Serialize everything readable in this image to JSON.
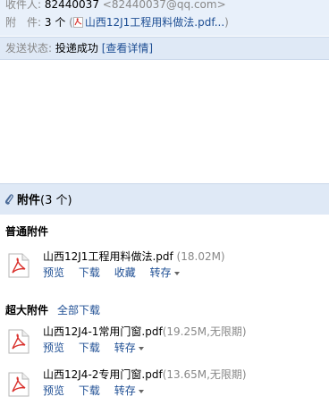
{
  "header": {
    "recipient_label": "收件人:",
    "recipient_name": "82440037",
    "recipient_email": "<82440037@qq.com>",
    "attachment_label": "附　件:",
    "attachment_count": "3 个",
    "attachment_preview_open": "(",
    "attachment_preview_name": "山西12J1工程用料做法.pdf...",
    "attachment_preview_close": ")"
  },
  "status": {
    "label": "发送状态:",
    "value": "投递成功",
    "details_link": "[查看详情]"
  },
  "attachments": {
    "title": "附件",
    "count": "(3 个)",
    "normal_section": {
      "title": "普通附件",
      "files": [
        {
          "name": "山西12J1工程用料做法.pdf",
          "size": "(18.02M)",
          "actions": [
            "预览",
            "下载",
            "收藏"
          ],
          "more": "转存"
        }
      ]
    },
    "large_section": {
      "title": "超大附件",
      "download_all": "全部下载",
      "files": [
        {
          "name": "山西12J4-1常用门窗.pdf",
          "size": "(19.25M,无限期)",
          "actions": [
            "预览",
            "下载"
          ],
          "more": "转存"
        },
        {
          "name": "山西12J4-2专用门窗.pdf",
          "size": "(13.65M,无限期)",
          "actions": [
            "预览",
            "下载"
          ],
          "more": "转存"
        }
      ]
    }
  },
  "icons": {
    "pdf": "pdf-file-icon",
    "clip": "paperclip-icon"
  },
  "colors": {
    "link": "#1f4f94",
    "header_bg": "#e8f0fa",
    "bar_bg": "#dfe9f6",
    "pdf_red": "#d9302c"
  }
}
